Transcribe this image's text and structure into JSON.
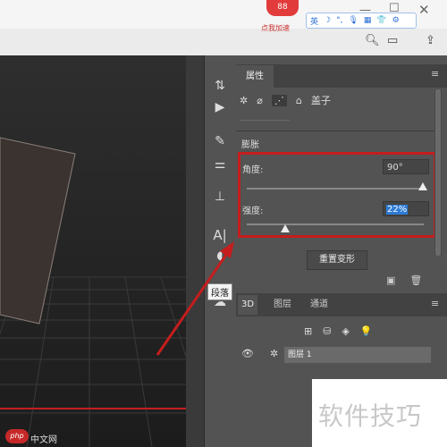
{
  "window": {
    "minimize_icon": "minimize-icon",
    "maximize_icon": "maximize-icon",
    "close_icon": "close-icon"
  },
  "overlay": {
    "badge_count": "88",
    "speed_label": "点我加速"
  },
  "ime": {
    "items": [
      "英",
      "☽",
      "°,",
      "🎙",
      "▦",
      "👕",
      "⚙"
    ]
  },
  "toolbar2": {
    "icons": [
      "search-icon",
      "panel-icon",
      "share-icon"
    ]
  },
  "tools": {
    "tooltip": "段落"
  },
  "properties": {
    "tab_label": "属性",
    "subtab_label": "盖子",
    "section_label": "膨胀",
    "angle_label": "角度:",
    "angle_value": "90°",
    "angle_fraction": 1.0,
    "strength_label": "强度:",
    "strength_value": "22%",
    "strength_fraction": 0.22,
    "reset_button": "重置变形"
  },
  "panel3d": {
    "tabs": [
      "3D",
      "图层",
      "通道"
    ],
    "layer_name": "图层 1"
  },
  "watermark": {
    "text": "软件技巧",
    "php_logo": "php",
    "php_site": "中文网"
  },
  "colors": {
    "highlight": "#c51d1d",
    "panel_bg": "#535353",
    "selection_blue": "#2d7bd6"
  }
}
